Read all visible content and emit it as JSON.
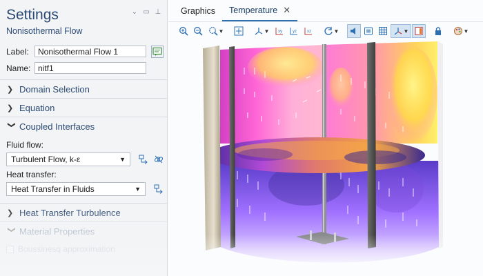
{
  "settings": {
    "title": "Settings",
    "subtitle": "Nonisothermal Flow",
    "label_field": {
      "label": "Label:",
      "value": "Nonisothermal Flow 1"
    },
    "name_field": {
      "label": "Name:",
      "value": "nitf1"
    },
    "sections": [
      {
        "title": "Domain Selection",
        "expanded": false
      },
      {
        "title": "Equation",
        "expanded": false
      },
      {
        "title": "Coupled Interfaces",
        "expanded": true
      },
      {
        "title": "Heat Transfer Turbulence",
        "expanded": false
      },
      {
        "title": "Material Properties",
        "expanded": true
      }
    ],
    "coupled": {
      "fluid_flow_label": "Fluid flow:",
      "fluid_flow_value": "Turbulent Flow, k-ε",
      "heat_transfer_label": "Heat transfer:",
      "heat_transfer_value": "Heat Transfer in Fluids"
    },
    "material": {
      "boussinesq_label": "Boussinesq approximation",
      "boussinesq_checked": false
    }
  },
  "graphics": {
    "tabs": [
      {
        "label": "Graphics",
        "active": false
      },
      {
        "label": "Temperature",
        "active": true
      }
    ],
    "toolbar_icons": [
      "zoom-in-icon",
      "zoom-out-icon",
      "zoom-box-icon",
      "zoom-extents-icon",
      "view-axes-icon",
      "view-xy-icon",
      "view-yz-icon",
      "view-xz-icon",
      "rotate-icon",
      "scene-light-icon",
      "transparency-icon",
      "grid-icon",
      "show-axes-icon",
      "legend-icon",
      "lock-icon",
      "color-scheme-icon"
    ]
  },
  "colors": {
    "accent": "#2d6fb3",
    "heading": "#2b4a73",
    "plasma_hot": "#ffe94a",
    "plasma_mid": "#ff5fcf",
    "plasma_cold": "#3a2a8f"
  }
}
